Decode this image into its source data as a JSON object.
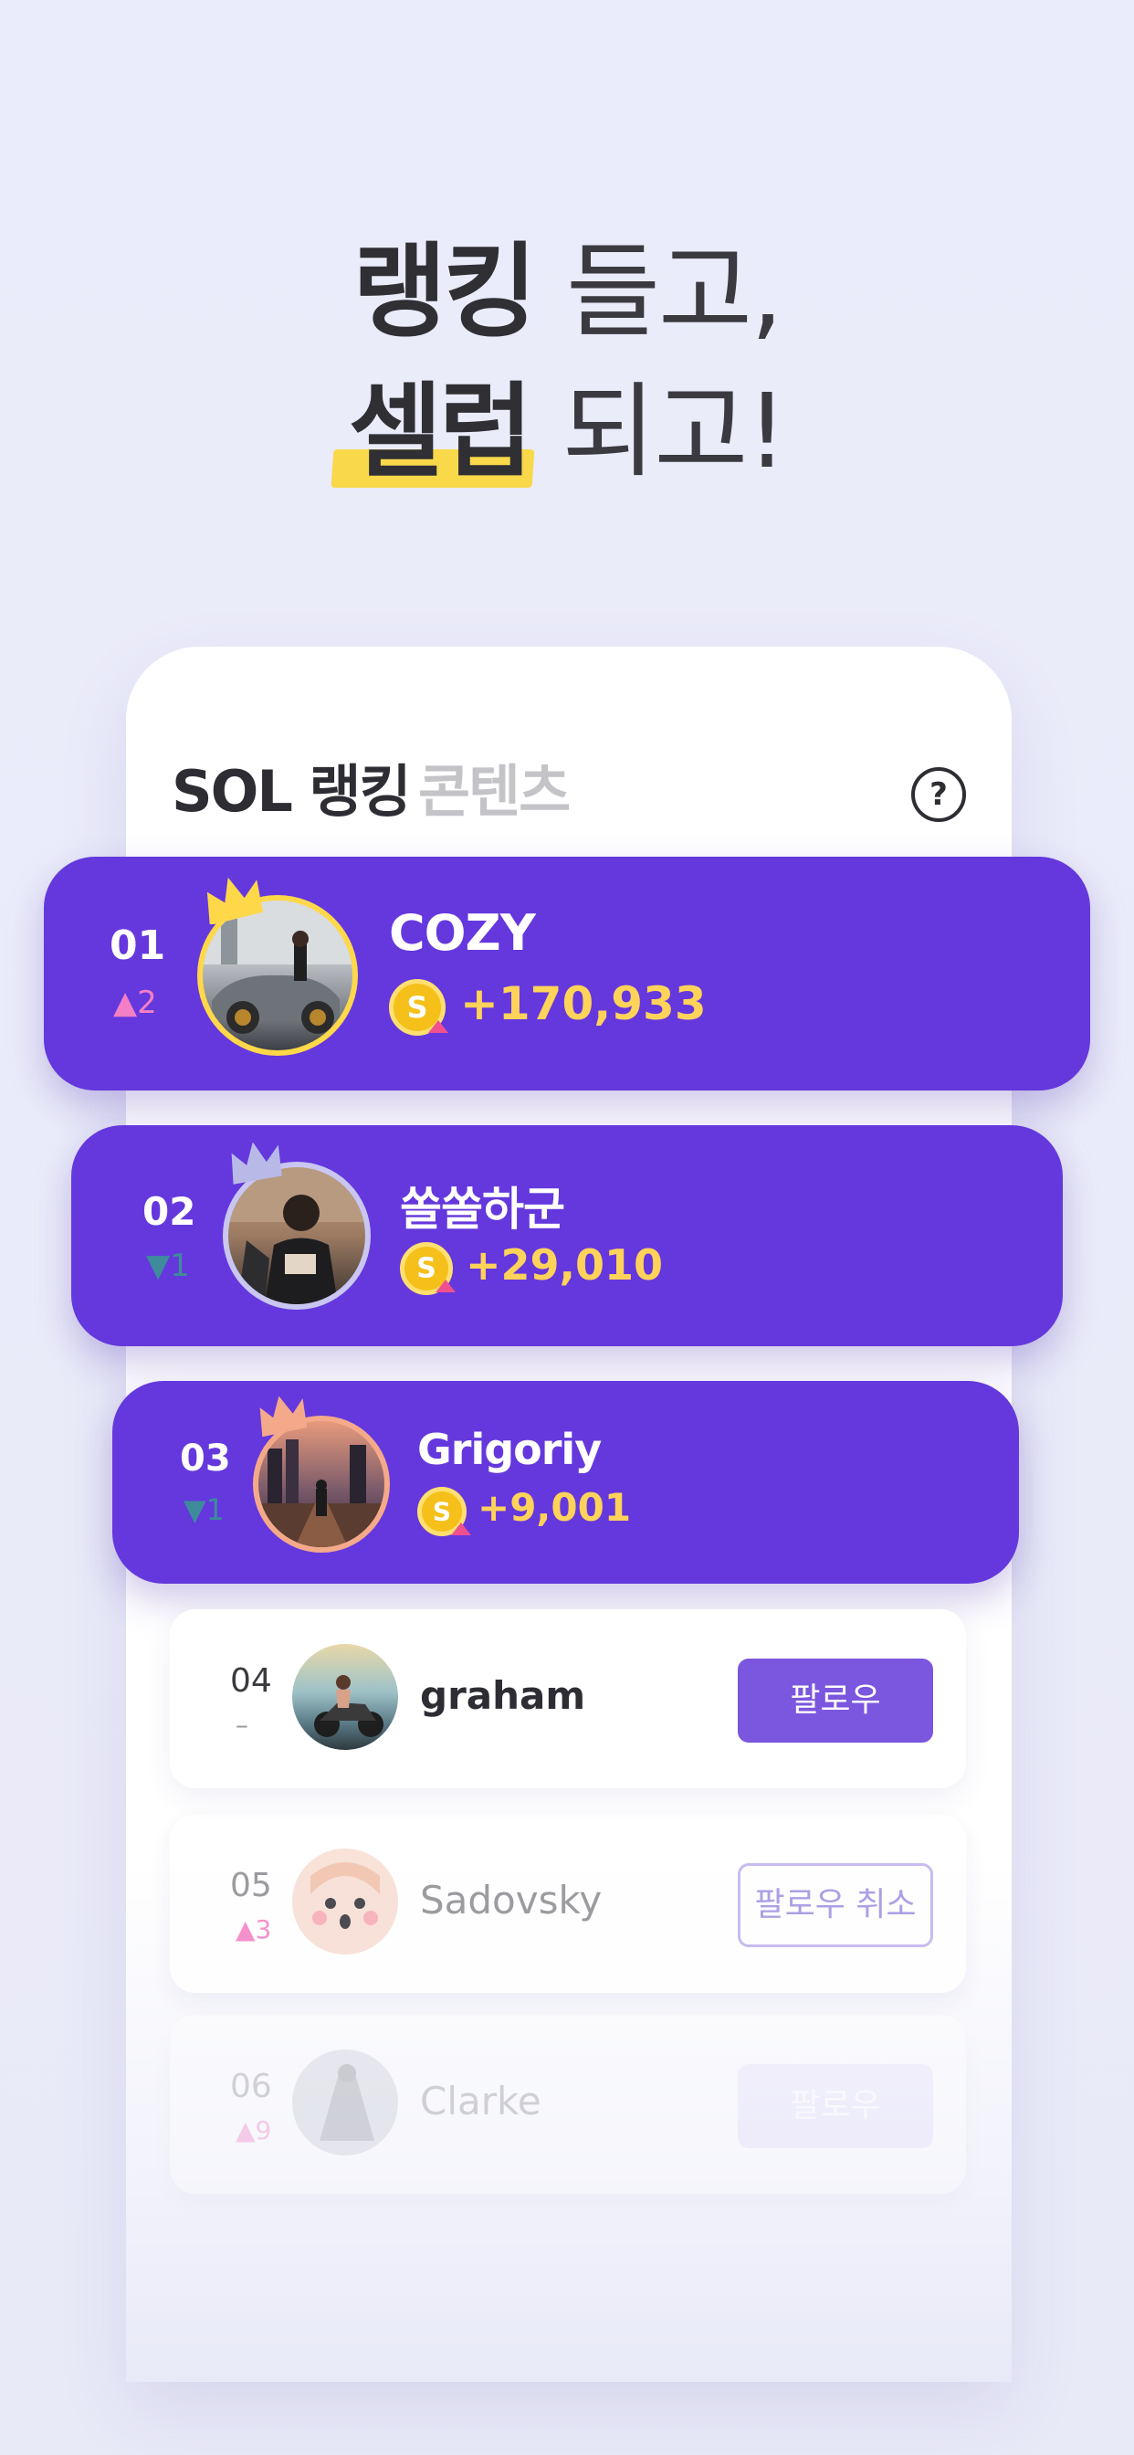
{
  "headline": {
    "line1_bold": "랭킹",
    "line1_rest": "들고,",
    "line2_bold": "셀럽",
    "line2_rest": "되고!"
  },
  "card": {
    "title": "SOL 랭킹",
    "tab": "콘텐츠",
    "help_icon": "?"
  },
  "top_ranks": [
    {
      "rank": "01",
      "delta": "2",
      "delta_dir": "up",
      "name": "COZY",
      "score": "+170,933",
      "crown_color": "#ffd84a",
      "ring_color": "#ffd84a"
    },
    {
      "rank": "02",
      "delta": "1",
      "delta_dir": "down",
      "name": "쏠쏠하군",
      "score": "+29,010",
      "crown_color": "#b9b9e8",
      "ring_color": "#c9c6f2"
    },
    {
      "rank": "03",
      "delta": "1",
      "delta_dir": "down",
      "name": "Grigoriy",
      "score": "+9,001",
      "crown_color": "#f4a98a",
      "ring_color": "#f4a98a"
    }
  ],
  "coin_symbol": "S",
  "rows": [
    {
      "rank": "04",
      "delta": "–",
      "delta_dir": "none",
      "name": "graham",
      "button": "팔로우",
      "button_style": "fill"
    },
    {
      "rank": "05",
      "delta": "3",
      "delta_dir": "up",
      "name": "Sadovsky",
      "button": "팔로우 취소",
      "button_style": "outline"
    },
    {
      "rank": "06",
      "delta": "9",
      "delta_dir": "up",
      "name": "Clarke",
      "button": "팔로우",
      "button_style": "fill-faded"
    }
  ],
  "colors": {
    "accent_purple": "#6438dd",
    "score_yellow": "#ffd25a",
    "highlight_yellow": "#f9d84a",
    "up_pink": "#f37fc4",
    "down_teal": "#3e8b9c"
  }
}
